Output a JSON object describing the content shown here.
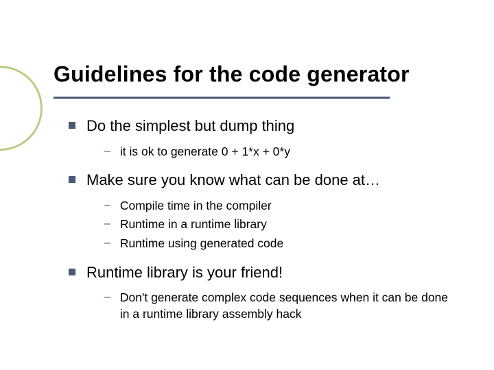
{
  "slide": {
    "title": "Guidelines for the code generator",
    "bullets": [
      {
        "text": "Do the simplest but dump thing",
        "subs": [
          "it is ok to generate 0 + 1*x + 0*y"
        ]
      },
      {
        "text": "Make sure you know what can be done at…",
        "subs": [
          "Compile time in the compiler",
          "Runtime in a runtime library",
          "Runtime using generated code"
        ]
      },
      {
        "text": "Runtime library is your friend!",
        "subs": [
          "Don't generate complex code sequences when it can be done in a runtime library assembly hack"
        ]
      }
    ]
  }
}
